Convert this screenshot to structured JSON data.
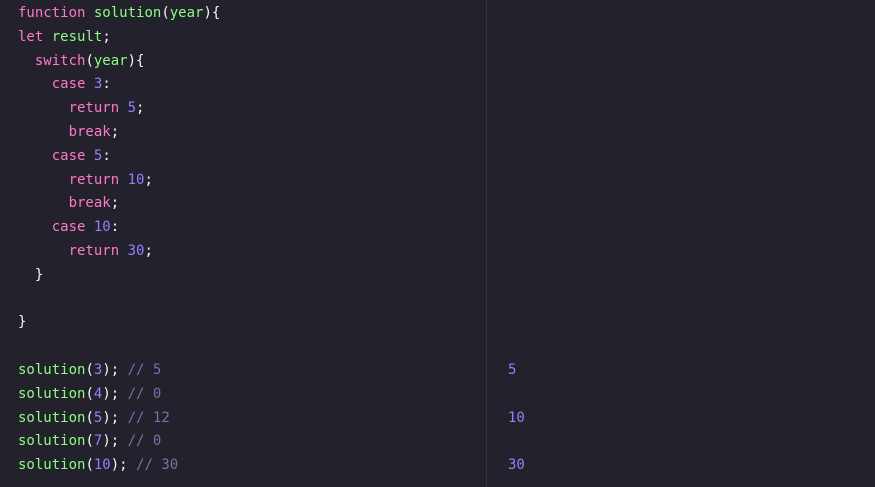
{
  "editor": {
    "lines": [
      [
        {
          "t": "function",
          "c": "kw"
        },
        {
          "t": " ",
          "c": "txt"
        },
        {
          "t": "solution",
          "c": "fn"
        },
        {
          "t": "(",
          "c": "txt"
        },
        {
          "t": "year",
          "c": "fn"
        },
        {
          "t": "){",
          "c": "txt"
        }
      ],
      [
        {
          "t": "let",
          "c": "kw"
        },
        {
          "t": " ",
          "c": "txt"
        },
        {
          "t": "result",
          "c": "fn"
        },
        {
          "t": ";",
          "c": "txt"
        }
      ],
      [
        {
          "t": "  ",
          "c": "txt"
        },
        {
          "t": "switch",
          "c": "kw"
        },
        {
          "t": "(",
          "c": "txt"
        },
        {
          "t": "year",
          "c": "fn"
        },
        {
          "t": "){",
          "c": "txt"
        }
      ],
      [
        {
          "t": "    ",
          "c": "txt"
        },
        {
          "t": "case",
          "c": "kw"
        },
        {
          "t": " ",
          "c": "txt"
        },
        {
          "t": "3",
          "c": "num"
        },
        {
          "t": ":",
          "c": "txt"
        }
      ],
      [
        {
          "t": "      ",
          "c": "txt"
        },
        {
          "t": "return",
          "c": "kw"
        },
        {
          "t": " ",
          "c": "txt"
        },
        {
          "t": "5",
          "c": "num"
        },
        {
          "t": ";",
          "c": "txt"
        }
      ],
      [
        {
          "t": "      ",
          "c": "txt"
        },
        {
          "t": "break",
          "c": "kw"
        },
        {
          "t": ";",
          "c": "txt"
        }
      ],
      [
        {
          "t": "    ",
          "c": "txt"
        },
        {
          "t": "case",
          "c": "kw"
        },
        {
          "t": " ",
          "c": "txt"
        },
        {
          "t": "5",
          "c": "num"
        },
        {
          "t": ":",
          "c": "txt"
        }
      ],
      [
        {
          "t": "      ",
          "c": "txt"
        },
        {
          "t": "return",
          "c": "kw"
        },
        {
          "t": " ",
          "c": "txt"
        },
        {
          "t": "10",
          "c": "num"
        },
        {
          "t": ";",
          "c": "txt"
        }
      ],
      [
        {
          "t": "      ",
          "c": "txt"
        },
        {
          "t": "break",
          "c": "kw"
        },
        {
          "t": ";",
          "c": "txt"
        }
      ],
      [
        {
          "t": "    ",
          "c": "txt"
        },
        {
          "t": "case",
          "c": "kw"
        },
        {
          "t": " ",
          "c": "txt"
        },
        {
          "t": "10",
          "c": "num"
        },
        {
          "t": ":",
          "c": "txt"
        }
      ],
      [
        {
          "t": "      ",
          "c": "txt"
        },
        {
          "t": "return",
          "c": "kw"
        },
        {
          "t": " ",
          "c": "txt"
        },
        {
          "t": "30",
          "c": "num"
        },
        {
          "t": ";",
          "c": "txt"
        }
      ],
      [
        {
          "t": "  }",
          "c": "txt"
        }
      ],
      [],
      [
        {
          "t": "}",
          "c": "txt"
        }
      ],
      [],
      [
        {
          "t": "solution",
          "c": "fn"
        },
        {
          "t": "(",
          "c": "txt"
        },
        {
          "t": "3",
          "c": "num"
        },
        {
          "t": "); ",
          "c": "txt"
        },
        {
          "t": "// 5",
          "c": "cmt"
        }
      ],
      [
        {
          "t": "solution",
          "c": "fn"
        },
        {
          "t": "(",
          "c": "txt"
        },
        {
          "t": "4",
          "c": "num"
        },
        {
          "t": "); ",
          "c": "txt"
        },
        {
          "t": "// 0",
          "c": "cmt"
        }
      ],
      [
        {
          "t": "solution",
          "c": "fn"
        },
        {
          "t": "(",
          "c": "txt"
        },
        {
          "t": "5",
          "c": "num"
        },
        {
          "t": "); ",
          "c": "txt"
        },
        {
          "t": "// 12",
          "c": "cmt"
        }
      ],
      [
        {
          "t": "solution",
          "c": "fn"
        },
        {
          "t": "(",
          "c": "txt"
        },
        {
          "t": "7",
          "c": "num"
        },
        {
          "t": "); ",
          "c": "txt"
        },
        {
          "t": "// 0",
          "c": "cmt"
        }
      ],
      [
        {
          "t": "solution",
          "c": "fn"
        },
        {
          "t": "(",
          "c": "txt"
        },
        {
          "t": "10",
          "c": "num"
        },
        {
          "t": "); ",
          "c": "txt"
        },
        {
          "t": "// 30",
          "c": "cmt"
        }
      ]
    ]
  },
  "results": {
    "lines": [
      "",
      "",
      "",
      "",
      "",
      "",
      "",
      "",
      "",
      "",
      "",
      "",
      "",
      "",
      "",
      "5",
      "",
      "10",
      "",
      "30"
    ]
  },
  "colors": {
    "background": "#22212c",
    "keyword": "#ff79c6",
    "function": "#8aff80",
    "number": "#9580ff",
    "comment": "#7970a9",
    "text": "#f8f8f2",
    "divider": "#34333f"
  }
}
